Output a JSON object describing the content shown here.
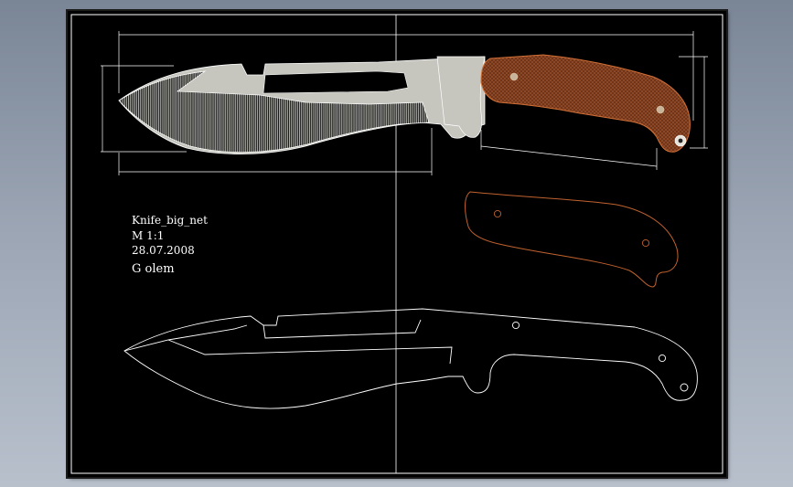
{
  "drawing": {
    "title_block": {
      "name": "Knife_big_net",
      "scale": "M 1:1",
      "date": "28.07.2008",
      "author": "G olem"
    },
    "dimensions": {
      "overall_length": "",
      "blade_length": "",
      "handle_length": "",
      "height": "",
      "spine_height": ""
    },
    "colors": {
      "background": "#000000",
      "line": "#ffffff",
      "blade_fill": "#c8c8c0",
      "handle_fill": "#7a3a1e",
      "handle_outline": "#c0622e"
    }
  }
}
